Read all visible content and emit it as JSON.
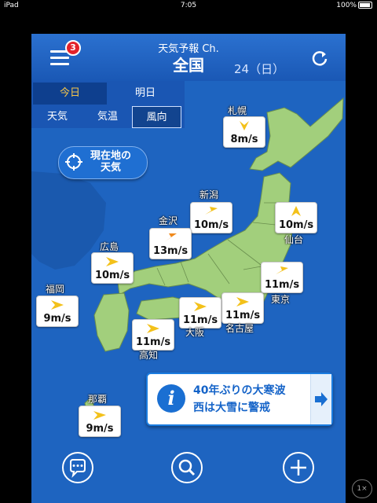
{
  "status": {
    "device": "iPad",
    "time": "7:05",
    "battery": "100%"
  },
  "header": {
    "subtitle": "天気予報 Ch.",
    "title": "全国",
    "date": "24（日）",
    "badge": "3"
  },
  "day_tabs": [
    {
      "label": "今日"
    },
    {
      "label": "明日"
    }
  ],
  "mode_tabs": [
    {
      "label": "天気"
    },
    {
      "label": "気温"
    },
    {
      "label": "風向"
    }
  ],
  "location_button": {
    "line1": "現在地の",
    "line2": "天気"
  },
  "cities": [
    {
      "name": "札幌",
      "speed": "8m/s",
      "arrow": "yellow"
    },
    {
      "name": "新潟",
      "speed": "10m/s",
      "arrow": "yellow"
    },
    {
      "name": "金沢",
      "speed": "13m/s",
      "arrow": "orange"
    },
    {
      "name": "仙台",
      "speed": "10m/s",
      "arrow": "yellow"
    },
    {
      "name": "広島",
      "speed": "10m/s",
      "arrow": "yellow"
    },
    {
      "name": "東京",
      "speed": "11m/s",
      "arrow": "yellow"
    },
    {
      "name": "福岡",
      "speed": "9m/s",
      "arrow": "yellow"
    },
    {
      "name": "名古屋",
      "speed": "11m/s",
      "arrow": "yellow"
    },
    {
      "name": "大阪",
      "speed": "11m/s",
      "arrow": "yellow"
    },
    {
      "name": "高知",
      "speed": "11m/s",
      "arrow": "yellow"
    },
    {
      "name": "那覇",
      "speed": "9m/s",
      "arrow": "yellow"
    }
  ],
  "alert": {
    "line1": "40年ぶりの大寒波",
    "line2": "西は大雪に警戒"
  },
  "bottom_icons": [
    "chat-icon",
    "search-icon",
    "plus-icon"
  ],
  "side_button": "1×",
  "colors": {
    "sea": "#1e64c0",
    "land": "#a2cf7c",
    "arrow_yellow": "#f3c11a",
    "arrow_orange": "#f08a1d",
    "alert_text": "#1463c8"
  }
}
